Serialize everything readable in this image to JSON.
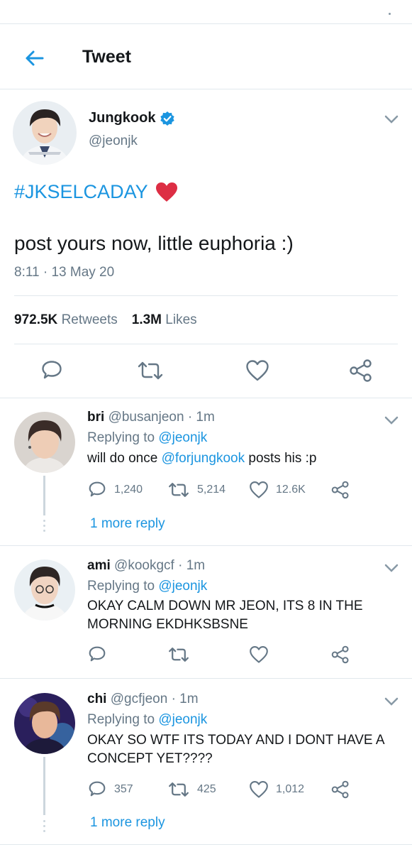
{
  "header": {
    "title": "Tweet"
  },
  "colors": {
    "accent": "#1b95e0",
    "heart": "#e0245e",
    "text": "#14171a",
    "muted": "#657786",
    "divider": "#e1e8ed"
  },
  "main_tweet": {
    "name": "Jungkook",
    "handle": "@jeonjk",
    "hashtag": "#JKSELCADAY",
    "text": "post yours now, little euphoria :)",
    "timestamp": "8:11 · 13 May 20",
    "retweets_count": "972.5K",
    "retweets_label": "Retweets",
    "likes_count": "1.3M",
    "likes_label": "Likes",
    "icons": [
      "reply-icon",
      "retweet-icon",
      "like-icon",
      "share-icon"
    ]
  },
  "replies": [
    {
      "name": "bri",
      "handle": "@busanjeon",
      "time": "· 1m",
      "replying_label": "Replying to",
      "replying_to": "@jeonjk",
      "text_before": "will do once ",
      "text_mention": "@forjungkook",
      "text_after": " posts his :p",
      "reply_count": "1,240",
      "retweet_count": "5,214",
      "like_count": "12.6K",
      "more_replies": "1 more reply"
    },
    {
      "name": "ami",
      "handle": "@kookgcf",
      "time": "· 1m",
      "replying_label": "Replying to",
      "replying_to": "@jeonjk",
      "text": "OKAY CALM DOWN MR JEON, ITS 8 IN THE MORNING EKDHKSBSNE"
    },
    {
      "name": "chi",
      "handle": "@gcfjeon",
      "time": "· 1m",
      "replying_label": "Replying to",
      "replying_to": "@jeonjk",
      "text": "OKAY SO WTF ITS TODAY AND I DONT HAVE A CONCEPT YET????",
      "reply_count": "357",
      "retweet_count": "425",
      "like_count": "1,012",
      "more_replies": "1 more reply"
    }
  ]
}
